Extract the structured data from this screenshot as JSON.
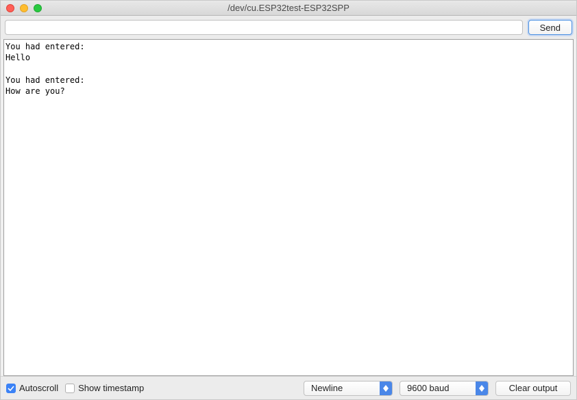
{
  "window": {
    "title": "/dev/cu.ESP32test-ESP32SPP"
  },
  "toolbar": {
    "input_value": "",
    "send_label": "Send"
  },
  "console_output": "You had entered:\nHello\n\nYou had entered:\nHow are you?",
  "bottombar": {
    "autoscroll_label": "Autoscroll",
    "autoscroll_checked": true,
    "timestamp_label": "Show timestamp",
    "timestamp_checked": false,
    "line_ending_selected": "Newline",
    "baud_selected": "9600 baud",
    "clear_label": "Clear output"
  }
}
